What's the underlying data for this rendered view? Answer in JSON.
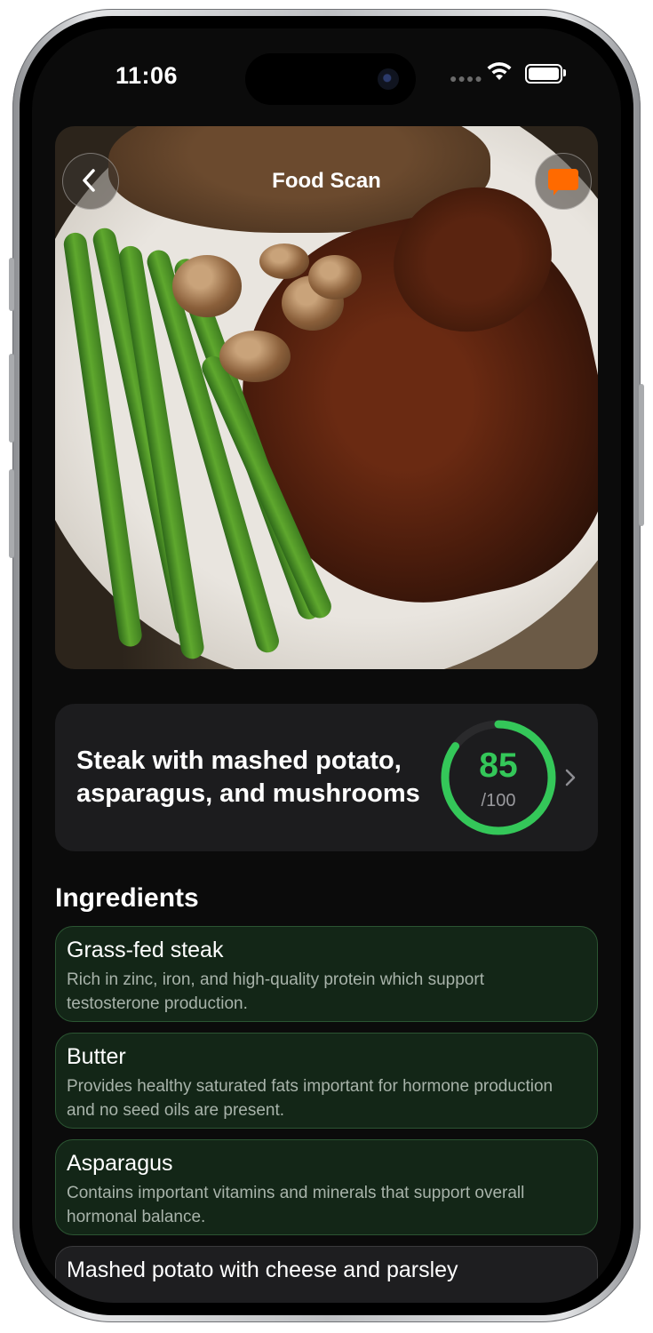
{
  "status_bar": {
    "time": "11:06"
  },
  "header": {
    "title": "Food Scan",
    "back_icon": "chevron-left-icon",
    "chat_icon": "chat-bubble-icon",
    "chat_color": "#ff6a00"
  },
  "meal": {
    "name": "Steak with mashed potato, asparagus, and mushrooms",
    "score": "85",
    "score_max": "/100",
    "score_fraction": 0.85,
    "ring_color": "#34c759"
  },
  "ingredients": {
    "title": "Ingredients",
    "items": [
      {
        "name": "Grass-fed steak",
        "description": "Rich in zinc, iron, and high-quality protein which support testosterone production."
      },
      {
        "name": "Butter",
        "description": "Provides healthy saturated fats important for hormone production and no seed oils are present."
      },
      {
        "name": "Asparagus",
        "description": "Contains important vitamins and minerals that support overall hormonal balance."
      },
      {
        "name": "Mashed potato with cheese and parsley",
        "description": ""
      }
    ]
  }
}
